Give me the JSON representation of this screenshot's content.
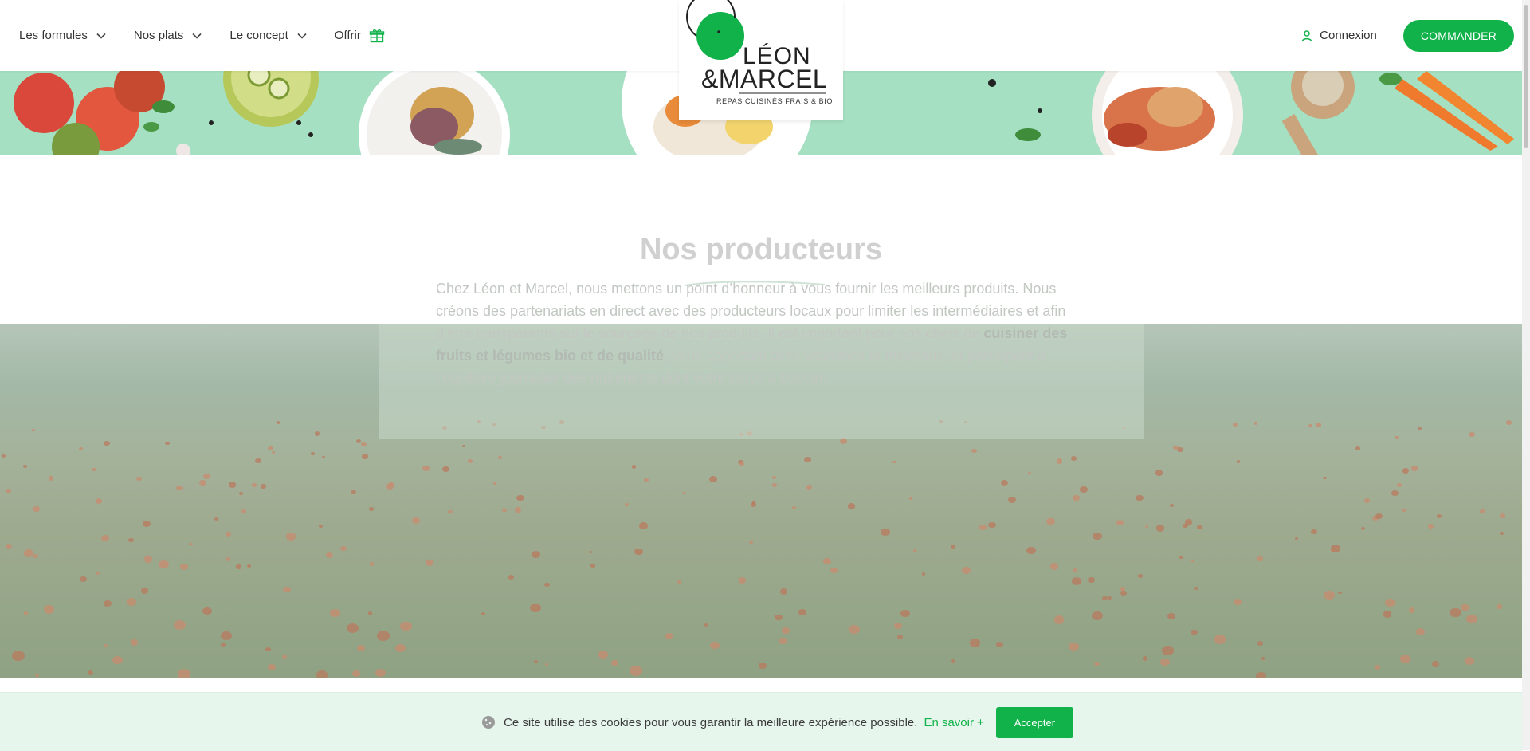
{
  "header": {
    "nav": [
      {
        "label": "Les formules",
        "icon": "chevron-down-icon"
      },
      {
        "label": "Nos plats",
        "icon": "chevron-down-icon"
      },
      {
        "label": "Le concept",
        "icon": "chevron-down-icon"
      },
      {
        "label": "Offrir",
        "icon": "gift-icon"
      }
    ],
    "login_label": "Connexion",
    "order_label": "COMMANDER"
  },
  "logo": {
    "line1": "LÉON",
    "line2": "&MARCEL",
    "tagline": "REPAS CUISINÉS FRAIS & BIO"
  },
  "producers": {
    "title": "Nos producteurs",
    "text_a": "Chez Léon et Marcel, nous mettons un point d’honneur à vous fournir les meilleurs produits. Nous créons des partenariats en direct avec des producteurs locaux pour limiter les intermédiaires et afin d’être transparents sur le sourçage de nos produits. Il est important pour nos chefs de ",
    "text_bold": "cuisiner des fruits et légumes bio et de qualité",
    "text_b": ", vous apportant ainsi vitamines et minéraux, et participant à l’équilibre journalier des nutriments dont votre corps a besoin."
  },
  "cookie": {
    "text": "Ce site utilise des cookies pour vous garantir la meilleure expérience possible.",
    "link_label": "En savoir +",
    "accept_label": "Accepter"
  },
  "colors": {
    "accent": "#11b24a",
    "banner": "#a6e0c2",
    "cookie_bg": "#e6f6ec"
  }
}
